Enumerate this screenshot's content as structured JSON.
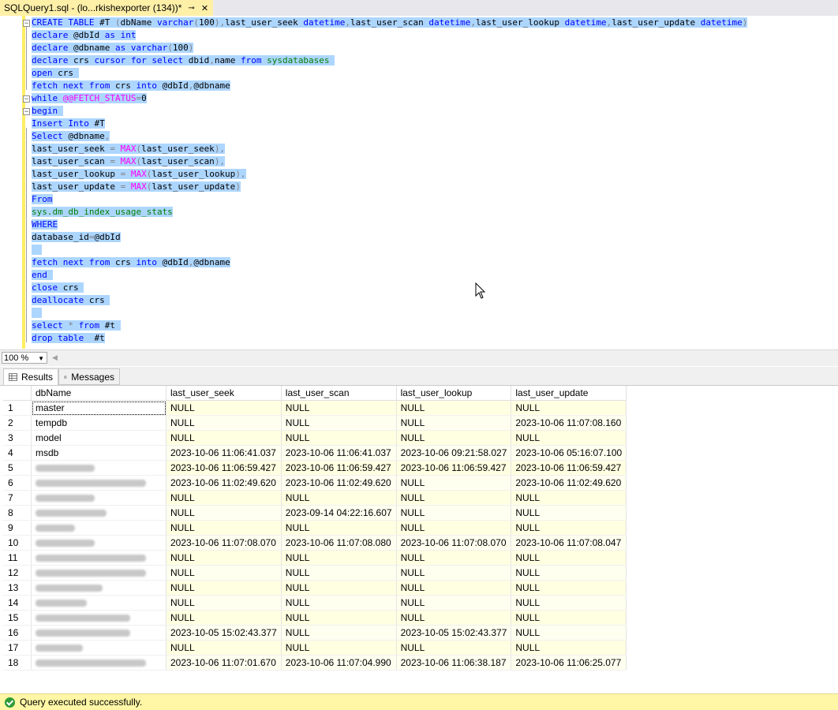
{
  "tab": {
    "title": "SQLQuery1.sql - (lo...rkishexporter (134))*",
    "pin_glyph": "⊸",
    "close_glyph": "✕"
  },
  "editor": {
    "lines": [
      [
        [
          "kw",
          "CREATE TABLE"
        ],
        [
          "t",
          " #T "
        ],
        [
          "op",
          "("
        ],
        [
          "t",
          "dbName "
        ],
        [
          "ty",
          "varchar"
        ],
        [
          "op",
          "("
        ],
        [
          "t",
          "100"
        ],
        [
          "op",
          "),"
        ],
        [
          "t",
          "last_user_seek "
        ],
        [
          "ty",
          "datetime"
        ],
        [
          "op",
          ","
        ],
        [
          "t",
          "last_user_scan "
        ],
        [
          "ty",
          "datetime"
        ],
        [
          "op",
          ","
        ],
        [
          "t",
          "last_user_lookup "
        ],
        [
          "ty",
          "datetime"
        ],
        [
          "op",
          ","
        ],
        [
          "t",
          "last_user_update "
        ],
        [
          "ty",
          "datetime"
        ],
        [
          "op",
          ")"
        ]
      ],
      [
        [
          "kw",
          "declare"
        ],
        [
          "t",
          " @dbId "
        ],
        [
          "kw",
          "as"
        ],
        [
          "t",
          " "
        ],
        [
          "ty",
          "int"
        ]
      ],
      [
        [
          "kw",
          "declare"
        ],
        [
          "t",
          " @dbname "
        ],
        [
          "kw",
          "as"
        ],
        [
          "t",
          " "
        ],
        [
          "ty",
          "varchar"
        ],
        [
          "op",
          "("
        ],
        [
          "t",
          "100"
        ],
        [
          "op",
          ")"
        ]
      ],
      [
        [
          "kw",
          "declare"
        ],
        [
          "t",
          " crs "
        ],
        [
          "kw",
          "cursor for select"
        ],
        [
          "t",
          " dbid"
        ],
        [
          "op",
          ","
        ],
        [
          "t",
          "name "
        ],
        [
          "kw",
          "from"
        ],
        [
          "t",
          " "
        ],
        [
          "sy",
          "sysdatabases"
        ],
        [
          "t",
          " "
        ]
      ],
      [
        [
          "kw",
          "open"
        ],
        [
          "t",
          " crs "
        ]
      ],
      [
        [
          "kw",
          "fetch next from"
        ],
        [
          "t",
          " crs "
        ],
        [
          "kw",
          "into"
        ],
        [
          "t",
          " @dbId"
        ],
        [
          "op",
          ","
        ],
        [
          "t",
          "@dbname"
        ]
      ],
      [
        [
          "kw",
          "while"
        ],
        [
          "t",
          " "
        ],
        [
          "fn",
          "@@FETCH_STATUS"
        ],
        [
          "op",
          "="
        ],
        [
          "t",
          "0"
        ]
      ],
      [
        [
          "kw",
          "begin"
        ],
        [
          "t",
          " "
        ]
      ],
      [
        [
          "kw",
          "Insert Into"
        ],
        [
          "t",
          " #T"
        ]
      ],
      [
        [
          "kw",
          "Select"
        ],
        [
          "t",
          " @dbname"
        ],
        [
          "op",
          ","
        ]
      ],
      [
        [
          "t",
          "last_user_seek "
        ],
        [
          "op",
          "="
        ],
        [
          "t",
          " "
        ],
        [
          "fn",
          "MAX"
        ],
        [
          "op",
          "("
        ],
        [
          "t",
          "last_user_seek"
        ],
        [
          "op",
          "),"
        ]
      ],
      [
        [
          "t",
          "last_user_scan "
        ],
        [
          "op",
          "="
        ],
        [
          "t",
          " "
        ],
        [
          "fn",
          "MAX"
        ],
        [
          "op",
          "("
        ],
        [
          "t",
          "last_user_scan"
        ],
        [
          "op",
          "),"
        ]
      ],
      [
        [
          "t",
          "last_user_lookup "
        ],
        [
          "op",
          "="
        ],
        [
          "t",
          " "
        ],
        [
          "fn",
          "MAX"
        ],
        [
          "op",
          "("
        ],
        [
          "t",
          "last_user_lookup"
        ],
        [
          "op",
          "),"
        ]
      ],
      [
        [
          "t",
          "last_user_update "
        ],
        [
          "op",
          "="
        ],
        [
          "t",
          " "
        ],
        [
          "fn",
          "MAX"
        ],
        [
          "op",
          "("
        ],
        [
          "t",
          "last_user_update"
        ],
        [
          "op",
          ")"
        ]
      ],
      [
        [
          "kw",
          "From"
        ]
      ],
      [
        [
          "sy",
          "sys.dm_db_index_usage_stats"
        ]
      ],
      [
        [
          "kw",
          "WHERE"
        ]
      ],
      [
        [
          "t",
          "database_id"
        ],
        [
          "op",
          "="
        ],
        [
          "t",
          "@dbId"
        ]
      ],
      [
        [
          "t",
          "  "
        ]
      ],
      [
        [
          "kw",
          "fetch next from"
        ],
        [
          "t",
          " crs "
        ],
        [
          "kw",
          "into"
        ],
        [
          "t",
          " @dbId"
        ],
        [
          "op",
          ","
        ],
        [
          "t",
          "@dbname"
        ]
      ],
      [
        [
          "kw",
          "end"
        ],
        [
          "t",
          " "
        ]
      ],
      [
        [
          "kw",
          "close"
        ],
        [
          "t",
          " crs "
        ]
      ],
      [
        [
          "kw",
          "deallocate"
        ],
        [
          "t",
          " crs "
        ]
      ],
      [
        [
          "t",
          "  "
        ]
      ],
      [
        [
          "kw",
          "select"
        ],
        [
          "t",
          " "
        ],
        [
          "op",
          "*"
        ],
        [
          "t",
          " "
        ],
        [
          "kw",
          "from"
        ],
        [
          "t",
          " #t "
        ]
      ],
      [
        [
          "kw",
          "drop table"
        ],
        [
          "t",
          "  #t"
        ]
      ]
    ]
  },
  "zoom": {
    "value": "100 %"
  },
  "result_tabs": {
    "results": "Results",
    "messages": "Messages"
  },
  "grid": {
    "columns": [
      "dbName",
      "last_user_seek",
      "last_user_scan",
      "last_user_lookup",
      "last_user_update"
    ],
    "rows": [
      [
        "1",
        "master",
        "NULL",
        "NULL",
        "NULL",
        "NULL"
      ],
      [
        "2",
        "tempdb",
        "NULL",
        "NULL",
        "NULL",
        "2023-10-06 11:07:08.160"
      ],
      [
        "3",
        "model",
        "NULL",
        "NULL",
        "NULL",
        "NULL"
      ],
      [
        "4",
        "msdb",
        "2023-10-06 11:06:41.037",
        "2023-10-06 11:06:41.037",
        "2023-10-06 09:21:58.027",
        "2023-10-06 05:16:07.100"
      ],
      [
        "5",
        "",
        "2023-10-06 11:06:59.427",
        "2023-10-06 11:06:59.427",
        "2023-10-06 11:06:59.427",
        "2023-10-06 11:06:59.427"
      ],
      [
        "6",
        "",
        "2023-10-06 11:02:49.620",
        "2023-10-06 11:02:49.620",
        "NULL",
        "2023-10-06 11:02:49.620"
      ],
      [
        "7",
        "",
        "NULL",
        "NULL",
        "NULL",
        "NULL"
      ],
      [
        "8",
        "",
        "NULL",
        "2023-09-14 04:22:16.607",
        "NULL",
        "NULL"
      ],
      [
        "9",
        "",
        "NULL",
        "NULL",
        "NULL",
        "NULL"
      ],
      [
        "10",
        "",
        "2023-10-06 11:07:08.070",
        "2023-10-06 11:07:08.080",
        "2023-10-06 11:07:08.070",
        "2023-10-06 11:07:08.047"
      ],
      [
        "11",
        "",
        "NULL",
        "NULL",
        "NULL",
        "NULL"
      ],
      [
        "12",
        "",
        "NULL",
        "NULL",
        "NULL",
        "NULL"
      ],
      [
        "13",
        "",
        "NULL",
        "NULL",
        "NULL",
        "NULL"
      ],
      [
        "14",
        "",
        "NULL",
        "NULL",
        "NULL",
        "NULL"
      ],
      [
        "15",
        "",
        "NULL",
        "NULL",
        "NULL",
        "NULL"
      ],
      [
        "16",
        "",
        "2023-10-05 15:02:43.377",
        "NULL",
        "2023-10-05 15:02:43.377",
        "NULL"
      ],
      [
        "17",
        "",
        "NULL",
        "NULL",
        "NULL",
        "NULL"
      ],
      [
        "18",
        "",
        "2023-10-06 11:07:01.670",
        "2023-10-06 11:07:04.990",
        "2023-10-06 11:06:38.187",
        "2023-10-06 11:06:25.077"
      ]
    ]
  },
  "status": {
    "text": "Query executed successfully."
  }
}
